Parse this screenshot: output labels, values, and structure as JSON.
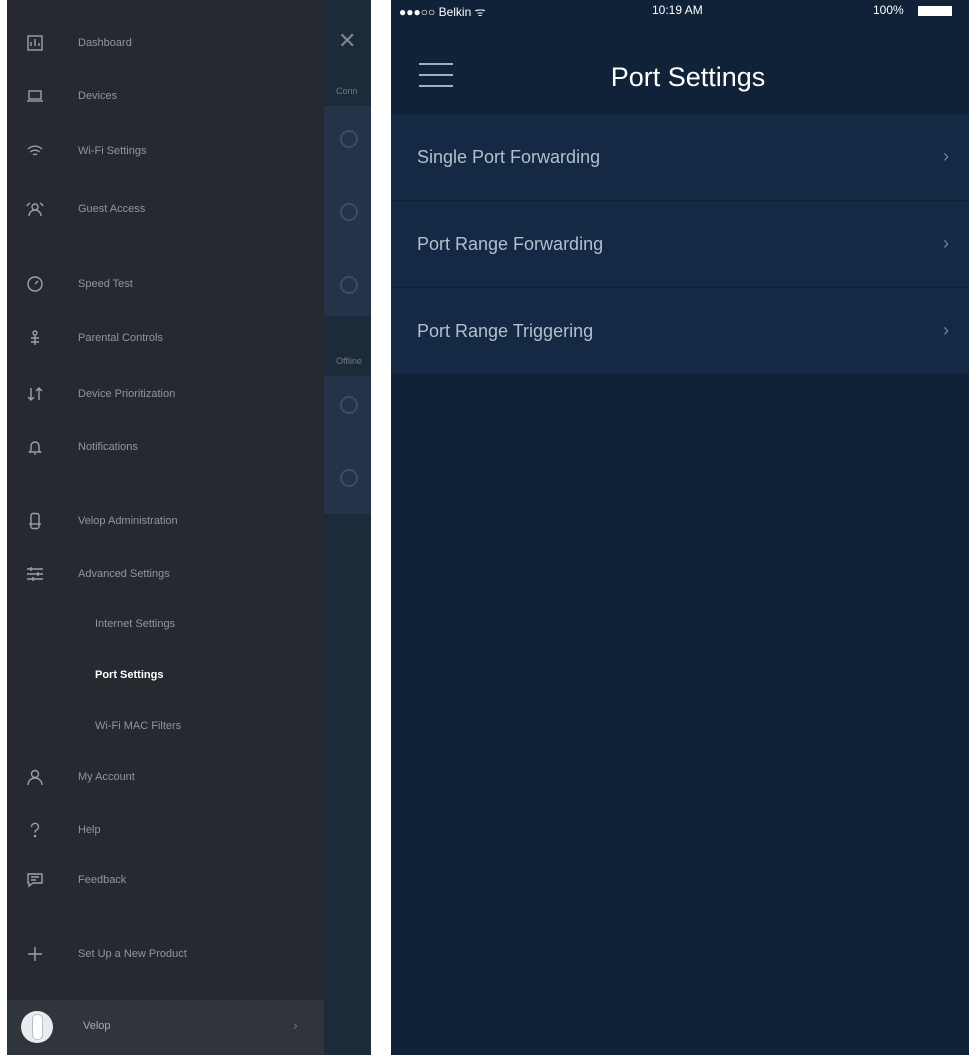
{
  "drawer": {
    "items": [
      {
        "label": "Dashboard",
        "icon": "dashboard-icon"
      },
      {
        "label": "Devices",
        "icon": "devices-icon"
      },
      {
        "label": "Wi-Fi Settings",
        "icon": "wifi-icon"
      },
      {
        "label": "Guest Access",
        "icon": "guest-access-icon"
      },
      {
        "label": "Speed Test",
        "icon": "speed-test-icon"
      },
      {
        "label": "Parental Controls",
        "icon": "parental-controls-icon"
      },
      {
        "label": "Device Prioritization",
        "icon": "prioritization-icon"
      },
      {
        "label": "Notifications",
        "icon": "bell-icon"
      },
      {
        "label": "Velop Administration",
        "icon": "velop-admin-icon"
      },
      {
        "label": "Advanced Settings",
        "icon": "sliders-icon"
      }
    ],
    "subitems": [
      {
        "label": "Internet Settings"
      },
      {
        "label": "Port Settings",
        "active": true
      },
      {
        "label": "Wi-Fi MAC Filters"
      }
    ],
    "bottom_items": [
      {
        "label": "My Account",
        "icon": "account-icon"
      },
      {
        "label": "Help",
        "icon": "help-icon"
      },
      {
        "label": "Feedback",
        "icon": "feedback-icon"
      },
      {
        "label": "Set Up a New Product",
        "icon": "plus-icon"
      }
    ],
    "footer": {
      "label": "Velop"
    }
  },
  "status_bar": {
    "carrier": "●●●○○ Belkin ᯤ",
    "time": "10:19 AM",
    "battery": "100%"
  },
  "header": {
    "title": "Port Settings"
  },
  "rows": [
    {
      "label": "Single Port Forwarding"
    },
    {
      "label": "Port Range Forwarding"
    },
    {
      "label": "Port Range Triggering"
    }
  ],
  "colors": {
    "drawer_bg": "#262a30",
    "page_bg": "#0f2238",
    "row_bg": "#142a44"
  }
}
